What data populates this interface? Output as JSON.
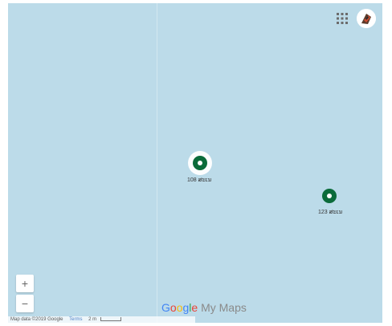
{
  "map": {
    "background_color": "#bcdbe9",
    "marker_color": "#0b6b3a"
  },
  "toolbar": {
    "apps_icon": "apps-grid-icon",
    "avatar_icon": "user-avatar"
  },
  "markers": [
    {
      "label": "108 ສະເນ",
      "selected": true
    },
    {
      "label": "123 ສະເນ",
      "selected": false
    }
  ],
  "zoom": {
    "in_label": "+",
    "out_label": "−"
  },
  "branding": {
    "google_letters": [
      "G",
      "o",
      "o",
      "g",
      "l",
      "e"
    ],
    "product": "My Maps"
  },
  "footer": {
    "map_data": "Map data ©2019 Google",
    "terms": "Terms",
    "scale": "2 m"
  }
}
